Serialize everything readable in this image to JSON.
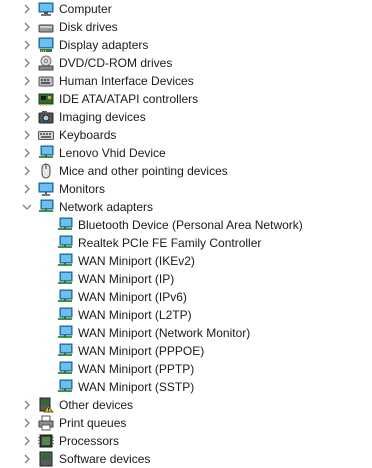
{
  "tree": {
    "categories_before": [
      {
        "label": "Computer",
        "icon": "computer-icon"
      },
      {
        "label": "Disk drives",
        "icon": "disk-drive-icon"
      },
      {
        "label": "Display adapters",
        "icon": "display-adapter-icon"
      },
      {
        "label": "DVD/CD-ROM drives",
        "icon": "dvd-drive-icon"
      },
      {
        "label": "Human Interface Devices",
        "icon": "hid-icon"
      },
      {
        "label": "IDE ATA/ATAPI controllers",
        "icon": "ide-controller-icon"
      },
      {
        "label": "Imaging devices",
        "icon": "camera-icon"
      },
      {
        "label": "Keyboards",
        "icon": "keyboard-icon"
      },
      {
        "label": "Lenovo Vhid Device",
        "icon": "network-monitor-icon"
      },
      {
        "label": "Mice and other pointing devices",
        "icon": "mouse-icon"
      },
      {
        "label": "Monitors",
        "icon": "monitor-icon"
      }
    ],
    "expanded_category": {
      "label": "Network adapters",
      "icon": "network-adapter-icon",
      "children": [
        "Bluetooth Device (Personal Area Network)",
        "Realtek PCIe FE Family Controller",
        "WAN Miniport (IKEv2)",
        "WAN Miniport (IP)",
        "WAN Miniport (IPv6)",
        "WAN Miniport (L2TP)",
        "WAN Miniport (Network Monitor)",
        "WAN Miniport (PPPOE)",
        "WAN Miniport (PPTP)",
        "WAN Miniport (SSTP)"
      ]
    },
    "categories_after": [
      {
        "label": "Other devices",
        "icon": "unknown-device-icon"
      },
      {
        "label": "Print queues",
        "icon": "printer-icon"
      },
      {
        "label": "Processors",
        "icon": "processor-icon"
      },
      {
        "label": "Software devices",
        "icon": "software-device-icon"
      }
    ]
  },
  "colors": {
    "chevron": "#808080",
    "monitor_blue": "#2b8fd6",
    "text": "#1a1a1a"
  }
}
